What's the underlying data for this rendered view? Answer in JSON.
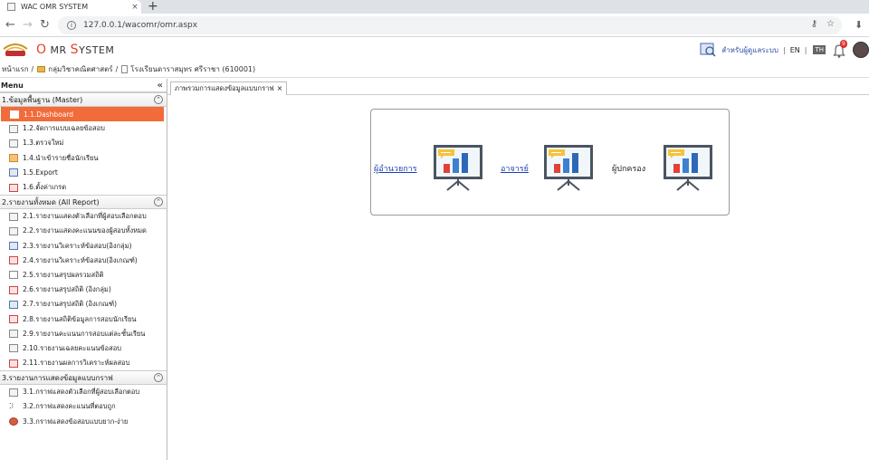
{
  "browser": {
    "tab_title": "WAC OMR SYSTEM",
    "tab_close": "×",
    "new_tab": "+",
    "url": "127.0.0.1/wacomr/omr.aspx"
  },
  "header": {
    "brand_o": "O",
    "brand_mr": "MR",
    "brand_s": "S",
    "brand_ystem": "YSTEM",
    "admin_label": "สำหรับผู้ดูแลระบบ",
    "lang_en": "EN",
    "lang_th": "TH",
    "notification_count": "9"
  },
  "breadcrumb": {
    "home": "หน้าแรก",
    "group": "กลุ่มวิชาคณิตศาสตร์",
    "school": "โรงเรียนดาราสมุทร ศรีราชา (610001)"
  },
  "sidebar": {
    "title": "Menu",
    "collapse": "«",
    "groups": [
      {
        "title": "1.ข้อมูลพื้นฐาน (Master)",
        "items": [
          {
            "label": "1.1.Dashboard",
            "icon": "dashboard-icon"
          },
          {
            "label": "1.2.จัดการแบบเฉลยข้อสอบ",
            "icon": "hierarchy-icon"
          },
          {
            "label": "1.3.ตรวจใหม่",
            "icon": "scan-icon"
          },
          {
            "label": "1.4.นำเข้ารายชื่อนักเรียน",
            "icon": "folder-icon"
          },
          {
            "label": "1.5.Export",
            "icon": "export-icon"
          },
          {
            "label": "1.6.ตั้งค่าเกรด",
            "icon": "settings-doc-icon"
          }
        ]
      },
      {
        "title": "2.รายงานทั้งหมด (All Report)",
        "items": [
          {
            "label": "2.1.รายงานแสดงตัวเลือกที่ผู้สอบเลือกตอบ",
            "icon": "report-icon"
          },
          {
            "label": "2.2.รายงานแสดงคะแนนของผู้สอบทั้งหมด",
            "icon": "report-icon"
          },
          {
            "label": "2.3.รายงานวิเคราะห์ข้อสอบ(อิงกลุ่ม)",
            "icon": "report-icon"
          },
          {
            "label": "2.4.รายงานวิเคราะห์ข้อสอบ(อิงเกณฑ์)",
            "icon": "report-red-icon"
          },
          {
            "label": "2.5.รายงานสรุปผลรวมสถิติ",
            "icon": "doc-icon"
          },
          {
            "label": "2.6.รายงานสรุปสถิติ (อิงกลุ่ม)",
            "icon": "report-red-icon"
          },
          {
            "label": "2.7.รายงานสรุปสถิติ (อิงเกณฑ์)",
            "icon": "chart-icon"
          },
          {
            "label": "2.8.รายงานสถิติข้อมูลการสอบนักเรียน",
            "icon": "report-icon"
          },
          {
            "label": "2.9.รายงานคะแนนการสอบแต่ละชั้นเรียน",
            "icon": "report-icon"
          },
          {
            "label": "2.10.รายงานเฉลยคะแนนข้อสอบ",
            "icon": "report-icon"
          },
          {
            "label": "2.11.รายงานผลการวิเคราะห์ผลสอบ",
            "icon": "report-icon"
          }
        ]
      },
      {
        "title": "3.รายงานการแสดงข้อมูลแบบกราฟ",
        "items": [
          {
            "label": "3.1.กราฟแสดงตัวเลือกที่ผู้สอบเลือกตอบ",
            "icon": "graph-icon"
          },
          {
            "label": "3.2.กราฟแสดงคะแนนที่ตอบถูก",
            "icon": "scatter-icon"
          },
          {
            "label": "3.3.กราฟแสดงข้อสอบแบบยาก-ง่าย",
            "icon": "pie-icon"
          }
        ]
      }
    ]
  },
  "main": {
    "tab_label": "ภาพรวมการแสดงข้อมูลแบบกราฟ",
    "tab_close": "×",
    "links": [
      {
        "label": "ผู้อำนวยการ",
        "linked": true
      },
      {
        "label": "อาจารย์",
        "linked": true
      },
      {
        "label": "ผู้ปกครอง",
        "linked": false
      }
    ]
  },
  "colors": {
    "accent": "#f26b3a",
    "brand_red": "#e8402a",
    "link": "#1a3fb0"
  }
}
